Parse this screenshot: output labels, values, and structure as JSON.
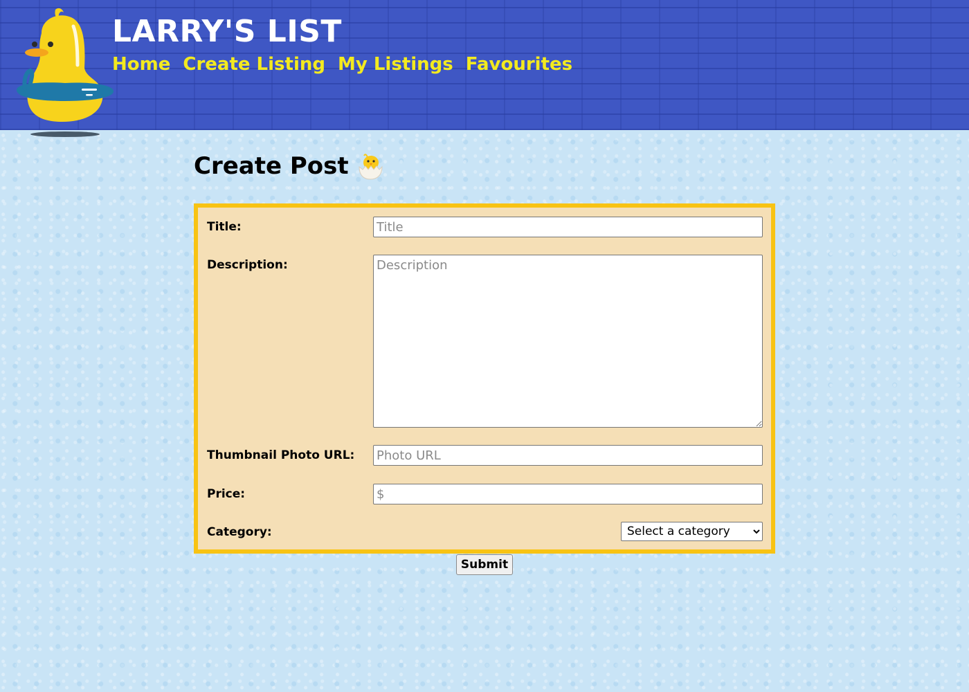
{
  "header": {
    "site_title": "LARRY'S LIST",
    "logo_icon": "duck-mascot-icon",
    "nav": [
      {
        "label": "Home"
      },
      {
        "label": "Create Listing"
      },
      {
        "label": "My Listings"
      },
      {
        "label": "Favourites"
      }
    ],
    "colors": {
      "background": "#3f57c4",
      "title": "#ffffff",
      "nav_link": "#f3ea1f"
    }
  },
  "main": {
    "heading": "Create Post",
    "heading_icon": "hatching-chick-icon",
    "form": {
      "title_label": "Title:",
      "title_placeholder": "Title",
      "title_value": "",
      "description_label": "Description:",
      "description_placeholder": "Description",
      "description_value": "",
      "photo_label": "Thumbnail Photo URL:",
      "photo_placeholder": "Photo URL",
      "photo_value": "",
      "price_label": "Price:",
      "price_placeholder": "$",
      "price_value": "",
      "category_label": "Category:",
      "category_selected": "Select a category",
      "submit_label": "Submit",
      "colors": {
        "panel": "#f5dfb6",
        "border": "#f8c313"
      }
    }
  }
}
